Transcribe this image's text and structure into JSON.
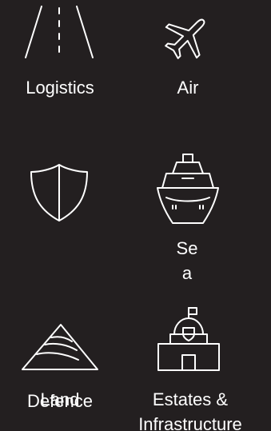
{
  "theme": {
    "background": "#231f20",
    "foreground": "#ffffff"
  },
  "tiles": [
    {
      "label": "Logistics",
      "icon": "road-icon"
    },
    {
      "label": "Air",
      "icon": "airplane-icon"
    },
    {
      "label": "Defence",
      "icon": "shield-icon"
    },
    {
      "label": "Sea",
      "icon": "ship-icon"
    },
    {
      "label": "Land",
      "icon": "land-terrain-icon"
    },
    {
      "label": "Estates & Infrastructure",
      "icon": "building-icon"
    }
  ]
}
